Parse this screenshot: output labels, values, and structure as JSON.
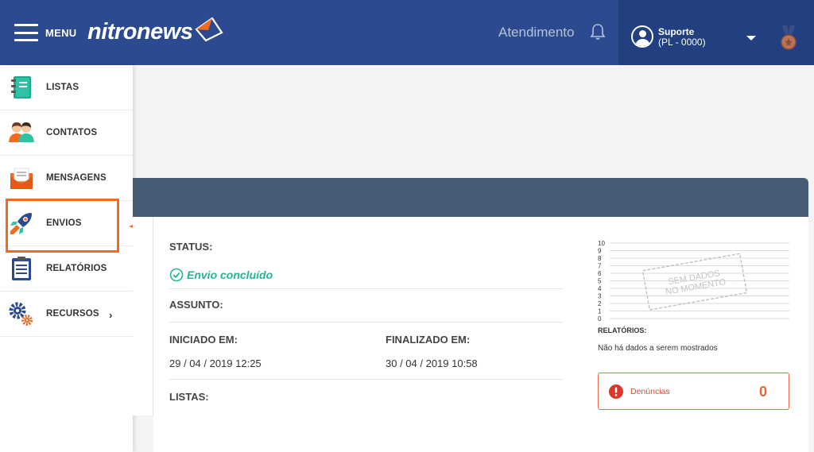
{
  "header": {
    "menu_label": "MENU",
    "logo_text": "nitronews",
    "atendimento": "Atendimento",
    "user": {
      "name": "Suporte",
      "code": "(PL - 0000)"
    }
  },
  "sidebar": {
    "items": [
      {
        "label": "LISTAS",
        "icon": "notebook-icon"
      },
      {
        "label": "CONTATOS",
        "icon": "contacts-icon"
      },
      {
        "label": "MENSAGENS",
        "icon": "envelope-icon"
      },
      {
        "label": "ENVIOS",
        "icon": "rocket-icon",
        "highlighted": true
      },
      {
        "label": "RELATÓRIOS",
        "icon": "clipboard-icon"
      },
      {
        "label": "RECURSOS",
        "icon": "gears-icon",
        "has_submenu": true
      }
    ]
  },
  "details": {
    "status_label": "STATUS:",
    "status_value": "Envio concluído",
    "assunto_label": "ASSUNTO:",
    "iniciado_label": "INICIADO EM:",
    "iniciado_value": "29 / 04 / 2019 12:25",
    "finalizado_label": "FINALIZADO EM:",
    "finalizado_value": "30 / 04 / 2019 10:58",
    "listas_label": "LISTAS:"
  },
  "chart_data": {
    "type": "line",
    "y_ticks": [
      "10",
      "9",
      "8",
      "7",
      "6",
      "5",
      "4",
      "3",
      "2",
      "1",
      "0"
    ],
    "ylim": [
      0,
      10
    ],
    "series": [],
    "stamp_text": [
      "SEM DADOS",
      "NO MOMENTO"
    ]
  },
  "reports": {
    "label": "RELATÓRIOS:",
    "message": "Não há dados a serem mostrados"
  },
  "denuncias": {
    "label": "Denúncias",
    "count": "0"
  },
  "colors": {
    "topbar": "#2b4a8f",
    "accent_orange": "#f06a24",
    "success": "#23b596",
    "danger": "#e8613c"
  }
}
